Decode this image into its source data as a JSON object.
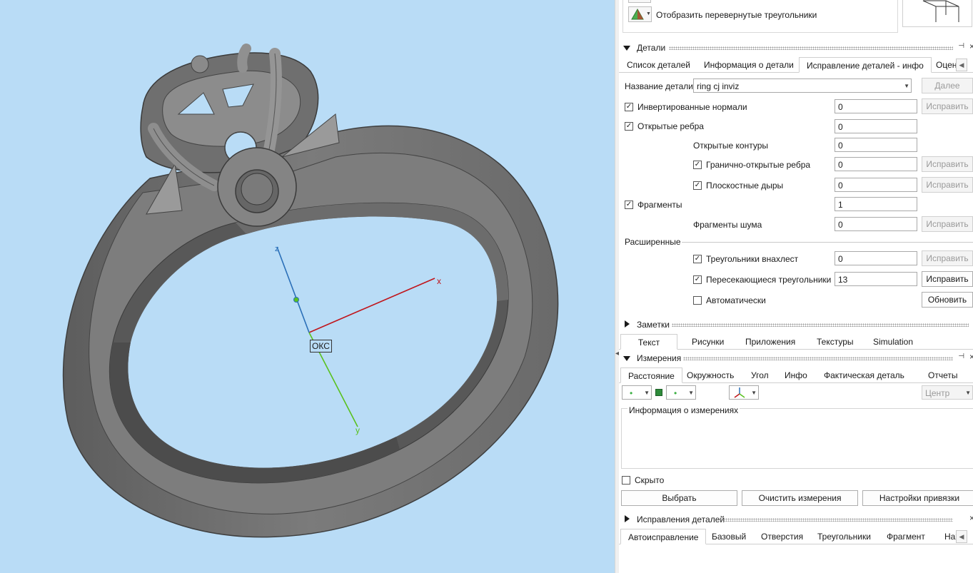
{
  "viewport": {
    "axes": {
      "x_label": "x",
      "y_label": "y",
      "z_label": "z",
      "origin_label": "ОКС"
    }
  },
  "top": {
    "inverted_triangles_label": "Отобразить перевернутые треугольники"
  },
  "details": {
    "title": "Детали",
    "tabs": [
      "Список деталей",
      "Информация о детали",
      "Исправление деталей - инфо",
      "Оцен"
    ],
    "active_tab": 2,
    "part_name_label": "Название детали",
    "part_name_value": "ring cj inviz",
    "next_button": "Далее",
    "rows": {
      "inverted_normals": {
        "label": "Инвертированные нормали",
        "checked": true,
        "value": "0",
        "button": "Исправить"
      },
      "open_edges": {
        "label": "Открытые ребра",
        "checked": true,
        "value": "0"
      },
      "open_contours": {
        "label": "Открытые контуры",
        "value": "0"
      },
      "boundary_open_edges": {
        "label": "Гранично-открытые ребра",
        "checked": true,
        "value": "0",
        "button": "Исправить"
      },
      "planar_holes": {
        "label": "Плоскостные дыры",
        "checked": true,
        "value": "0",
        "button": "Исправить"
      },
      "fragments": {
        "label": "Фрагменты",
        "checked": true,
        "value": "1"
      },
      "noise_fragments": {
        "label": "Фрагменты шума",
        "value": "0",
        "button": "Исправить"
      },
      "advanced_label": "Расширенные",
      "overlapping_triangles": {
        "label": "Треугольники внахлест",
        "checked": true,
        "value": "0",
        "button": "Исправить"
      },
      "intersecting_triangles": {
        "label": "Пересекающиеся треугольники",
        "checked": true,
        "value": "13",
        "button": "Исправить"
      },
      "automatic": {
        "label": "Автоматически",
        "checked": false,
        "button": "Обновить"
      }
    }
  },
  "notes": {
    "title": "Заметки",
    "tabs": [
      "Текст",
      "Рисунки",
      "Приложения",
      "Текстуры",
      "Simulation"
    ],
    "active_tab": 0
  },
  "measurements": {
    "title": "Измерения",
    "tabs": [
      "Расстояние",
      "Окружность",
      "Угол",
      "Инфо",
      "Фактическая деталь",
      "Отчеты"
    ],
    "active_tab": 0,
    "center_select": "Центр",
    "info_label": "Информация о измерениях",
    "hidden_label": "Скрыто",
    "hidden_checked": false,
    "buttons": [
      "Выбрать",
      "Очистить измерения",
      "Настройки привязки"
    ]
  },
  "part_fixes": {
    "title": "Исправления деталей",
    "tabs": [
      "Автоисправление",
      "Базовый",
      "Отверстия",
      "Треугольники",
      "Фрагмент",
      "Нахл"
    ],
    "active_tab": 0
  },
  "colors": {
    "viewport_bg": "#b9dcf6",
    "axis_x": "#c0151b",
    "axis_y": "#59c11e",
    "axis_z": "#2a6fb8",
    "model": "#6e6e6e"
  }
}
